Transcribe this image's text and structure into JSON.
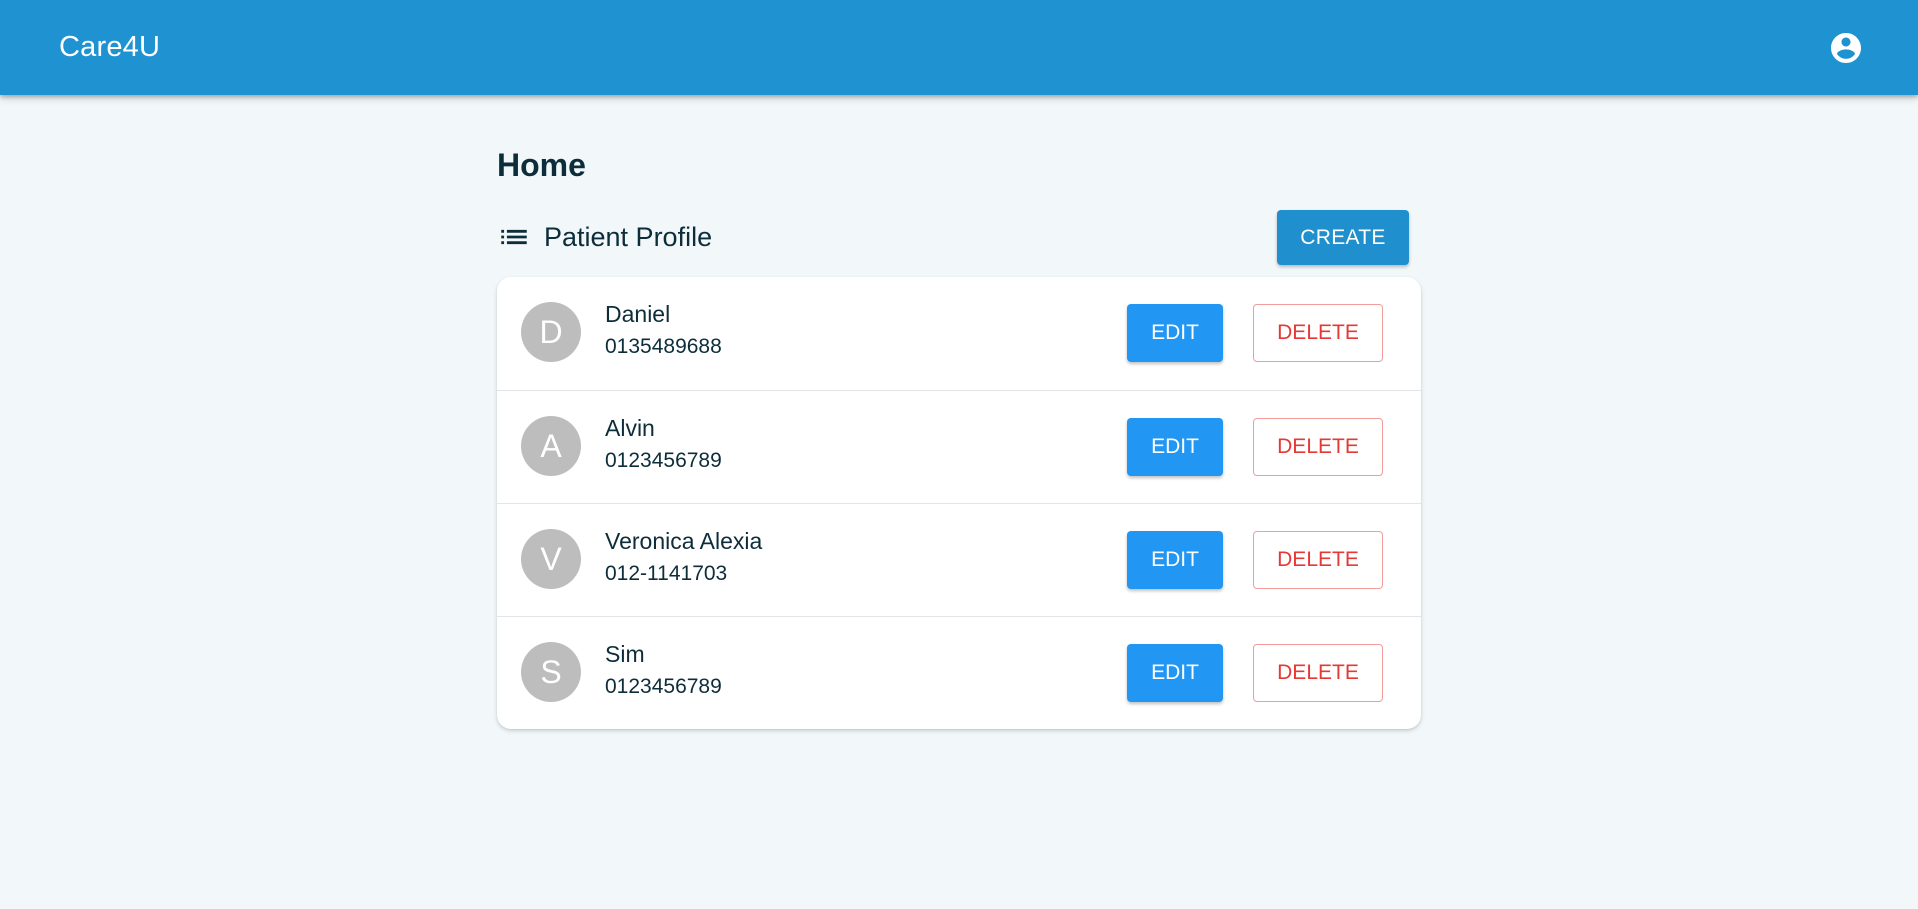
{
  "appbar": {
    "brand": "Care4U",
    "account_icon": "account-circle-icon",
    "background": "#1f93d2"
  },
  "page": {
    "title": "Home"
  },
  "section": {
    "icon": "list-icon",
    "title": "Patient Profile",
    "create_label": "CREATE"
  },
  "patients": [
    {
      "initial": "D",
      "name": "Daniel",
      "phone": "0135489688",
      "edit_label": "EDIT",
      "delete_label": "DELETE"
    },
    {
      "initial": "A",
      "name": "Alvin",
      "phone": "0123456789",
      "edit_label": "EDIT",
      "delete_label": "DELETE"
    },
    {
      "initial": "V",
      "name": "Veronica Alexia",
      "phone": "012-1141703",
      "edit_label": "EDIT",
      "delete_label": "DELETE"
    },
    {
      "initial": "S",
      "name": "Sim",
      "phone": "0123456789",
      "edit_label": "EDIT",
      "delete_label": "DELETE"
    }
  ],
  "colors": {
    "primary": "#2196f3",
    "danger": "#e53935",
    "avatar": "#bdbdbd"
  }
}
